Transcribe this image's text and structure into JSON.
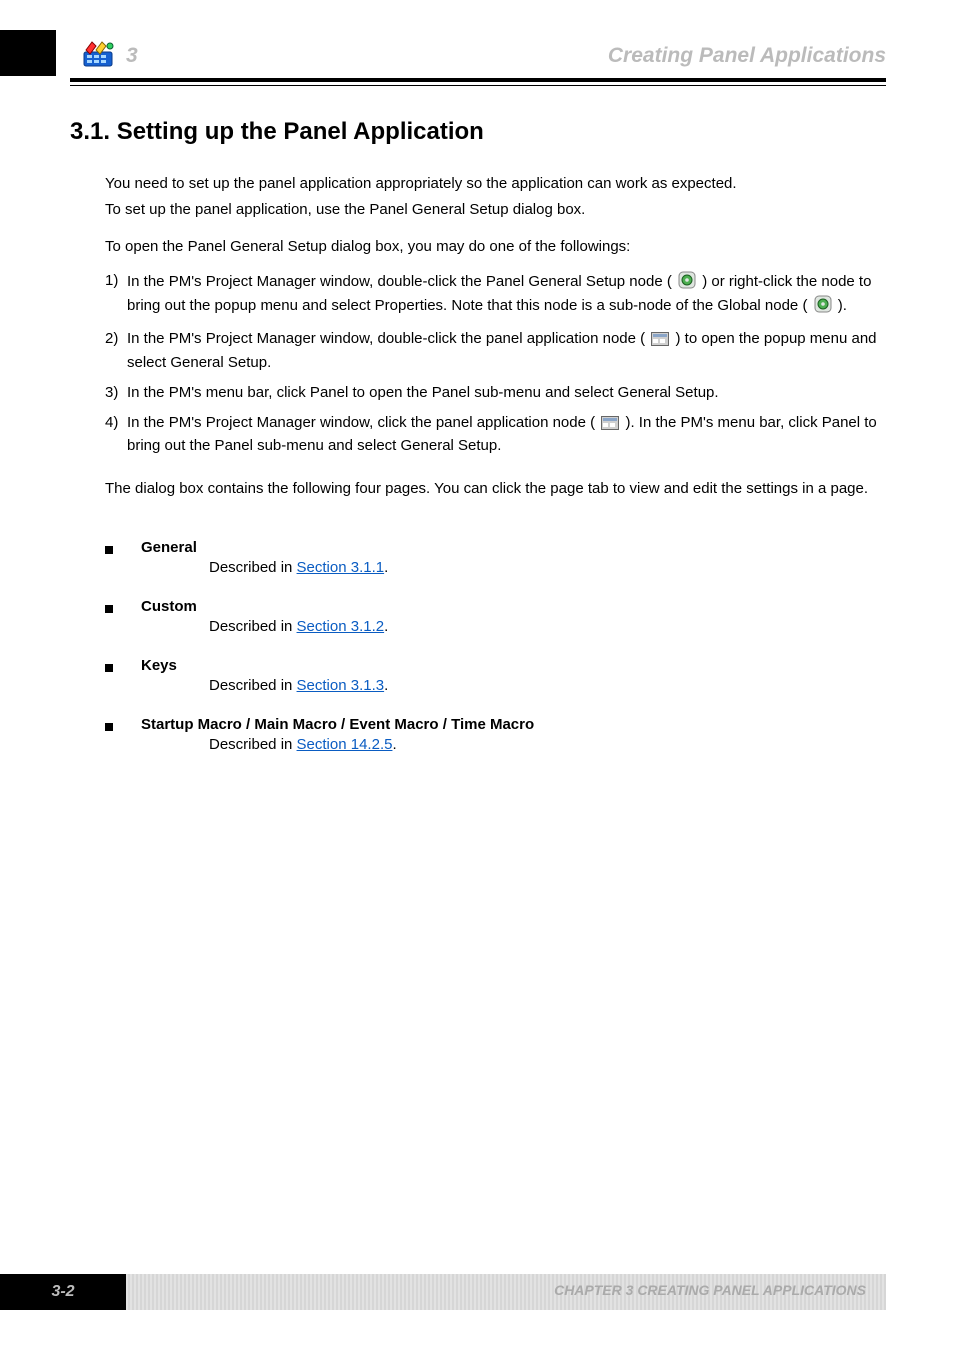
{
  "header": {
    "chapter_number": "3",
    "chapter_title": "Creating Panel Applications"
  },
  "section": {
    "number": "3.1.",
    "title": "Setting up the Panel Application"
  },
  "intro": {
    "line1": "You need to set up the panel application appropriately so the application can work as expected.",
    "line2": "To set up the panel application, use the Panel General Setup dialog box.",
    "methods_lead": "To open the Panel General Setup dialog box, you may do one of the followings:",
    "methods": [
      {
        "n": "1)",
        "text_a": "In the PM's Project Manager window, double-click the Panel General Setup node (",
        "text_b": ") or right-click the node to bring out the popup menu and select Properties. Note that this node is a sub-node of the Global node (",
        "text_c": ")."
      },
      {
        "n": "2)",
        "text_a": "In the PM's Project Manager window, double-click the panel application node (",
        "text_b": ") to open the popup menu and select General Setup."
      },
      {
        "n": "3)",
        "text_a": "In the PM's menu bar, click Panel to open the Panel sub-menu and select General Setup."
      },
      {
        "n": "4)",
        "text_a": "In the PM's Project Manager window, click the panel application node (",
        "text_b": "). In the PM's menu bar, click Panel to bring out the Panel sub-menu and select General Setup."
      }
    ],
    "dialog_pages_lead": "The dialog box contains the following four pages. You can click the page tab to view and edit the settings in a page."
  },
  "pages": [
    {
      "name": "General",
      "desc_a": "Described in ",
      "link": "Section 3.1.1",
      "desc_b": "."
    },
    {
      "name": "Custom",
      "desc_a": "Described in ",
      "link": "Section 3.1.2",
      "desc_b": "."
    },
    {
      "name": "Keys",
      "desc_a": "Described in ",
      "link": "Section 3.1.3",
      "desc_b": "."
    },
    {
      "name": "Startup Macro / Main Macro / Event Macro / Time Macro",
      "desc_a": "Described in ",
      "link": "Section 14.2.5",
      "desc_b": "."
    }
  ],
  "footer": {
    "page_ref": "3-2",
    "product": "CHAPTER 3    CREATING PANEL APPLICATIONS"
  },
  "icons": {
    "gear_green": "gear-green",
    "panel_gray": "panel-gray"
  }
}
